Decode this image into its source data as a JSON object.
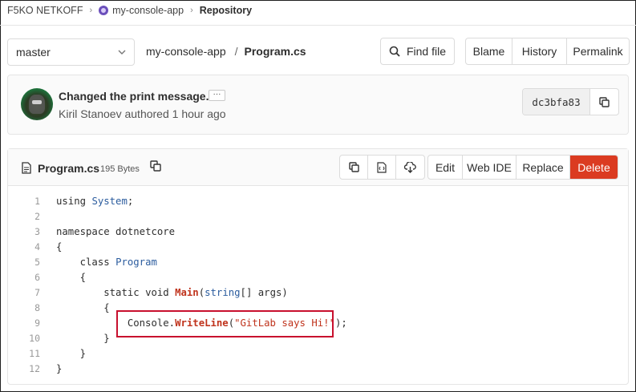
{
  "breadcrumb": {
    "group": "F5KO NETKOFF",
    "project": "my-console-app",
    "current": "Repository"
  },
  "toolbar": {
    "branch": "master",
    "path_root": "my-console-app",
    "path_sep": "/",
    "path_file": "Program.cs",
    "find_file": "Find file",
    "blame": "Blame",
    "history": "History",
    "permalink": "Permalink"
  },
  "commit": {
    "message": "Changed the print message.",
    "ellipsis": "···",
    "author_line": "Kiril Stanoev authored 1 hour ago",
    "sha": "dc3bfa83"
  },
  "file": {
    "name": "Program.cs",
    "size": "195 Bytes",
    "edit": "Edit",
    "web_ide": "Web IDE",
    "replace": "Replace",
    "delete": "Delete"
  },
  "code": {
    "line_numbers": [
      "1",
      "2",
      "3",
      "4",
      "5",
      "6",
      "7",
      "8",
      "9",
      "10",
      "11",
      "12"
    ],
    "l1_kw": "using",
    "l1_ns": "System",
    "l1_end": ";",
    "l3_kw": "namespace",
    "l3_name": "dotnetcore",
    "brace_open": "{",
    "brace_close": "}",
    "l5_kw": "class",
    "l5_name": "Program",
    "l7_static": "static",
    "l7_void": "void",
    "l7_main": "Main",
    "l7_paren": "(",
    "l7_type": "string",
    "l7_args": "[] args)",
    "l9_obj": "Console",
    "l9_dot": ".",
    "l9_fn": "WriteLine",
    "l9_open": "(",
    "l9_str": "\"GitLab says Hi!\"",
    "l9_close": ");"
  },
  "colors": {
    "delete_bg": "#db3b21",
    "highlight_border": "#c8102e",
    "string": "#c0341d",
    "type": "#2b5c9e"
  }
}
